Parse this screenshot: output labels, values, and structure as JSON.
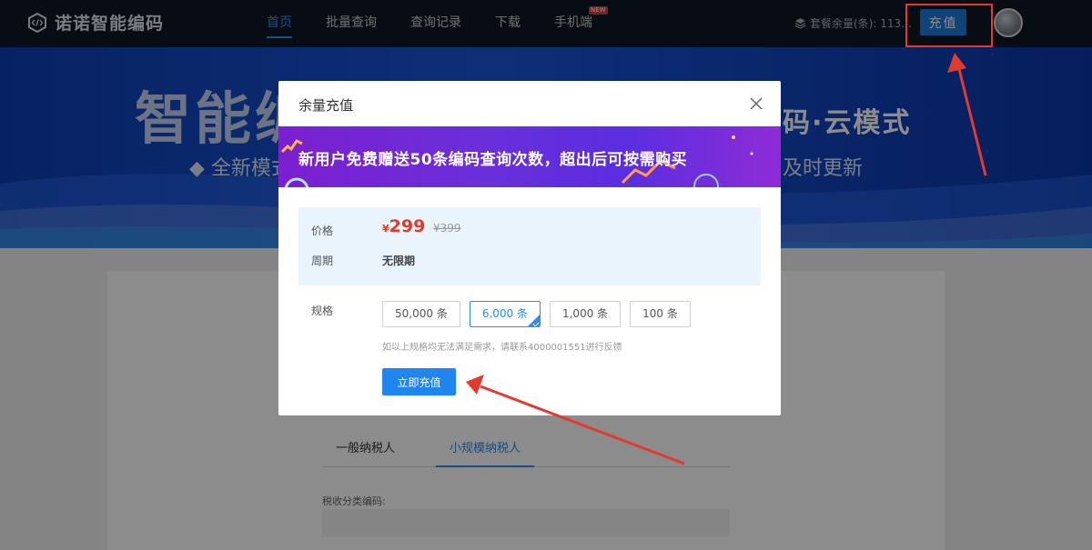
{
  "header": {
    "logo_text": "诺诺智能编码",
    "nav": [
      {
        "label": "首页",
        "active": true
      },
      {
        "label": "批量查询"
      },
      {
        "label": "查询记录"
      },
      {
        "label": "下载"
      },
      {
        "label": "手机端",
        "badge": "NEW"
      }
    ],
    "quota_text": "套餐余量(条): 113…",
    "recharge_label": "充值"
  },
  "banner": {
    "title": "智能编码",
    "title_right": "码·云模式",
    "subtitle_left": "◆ 全新模式",
    "subtitle_right": "及时更新"
  },
  "content": {
    "tabs": [
      {
        "label": "一般纳税人"
      },
      {
        "label": "小规模纳税人",
        "active": true
      }
    ],
    "field_label": "税收分类编码:"
  },
  "modal": {
    "title": "余量充值",
    "promo": "新用户免费赠送50条编码查询次数，超出后可按需购买",
    "price_label": "价格",
    "price_currency": "¥",
    "price_now": "299",
    "price_old": "¥399",
    "period_label": "周期",
    "period_value": "无限期",
    "spec_label": "规格",
    "spec_options": [
      "50,000 条",
      "6,000 条",
      "1,000 条",
      "100 条"
    ],
    "spec_selected_index": 1,
    "spec_note": "如以上规格均无法满足需求，请联系4000001551进行反馈",
    "buy_label": "立即充值"
  },
  "colors": {
    "accent": "#1f86f0",
    "price": "#e03c2b",
    "annotation": "#e33a2f"
  }
}
